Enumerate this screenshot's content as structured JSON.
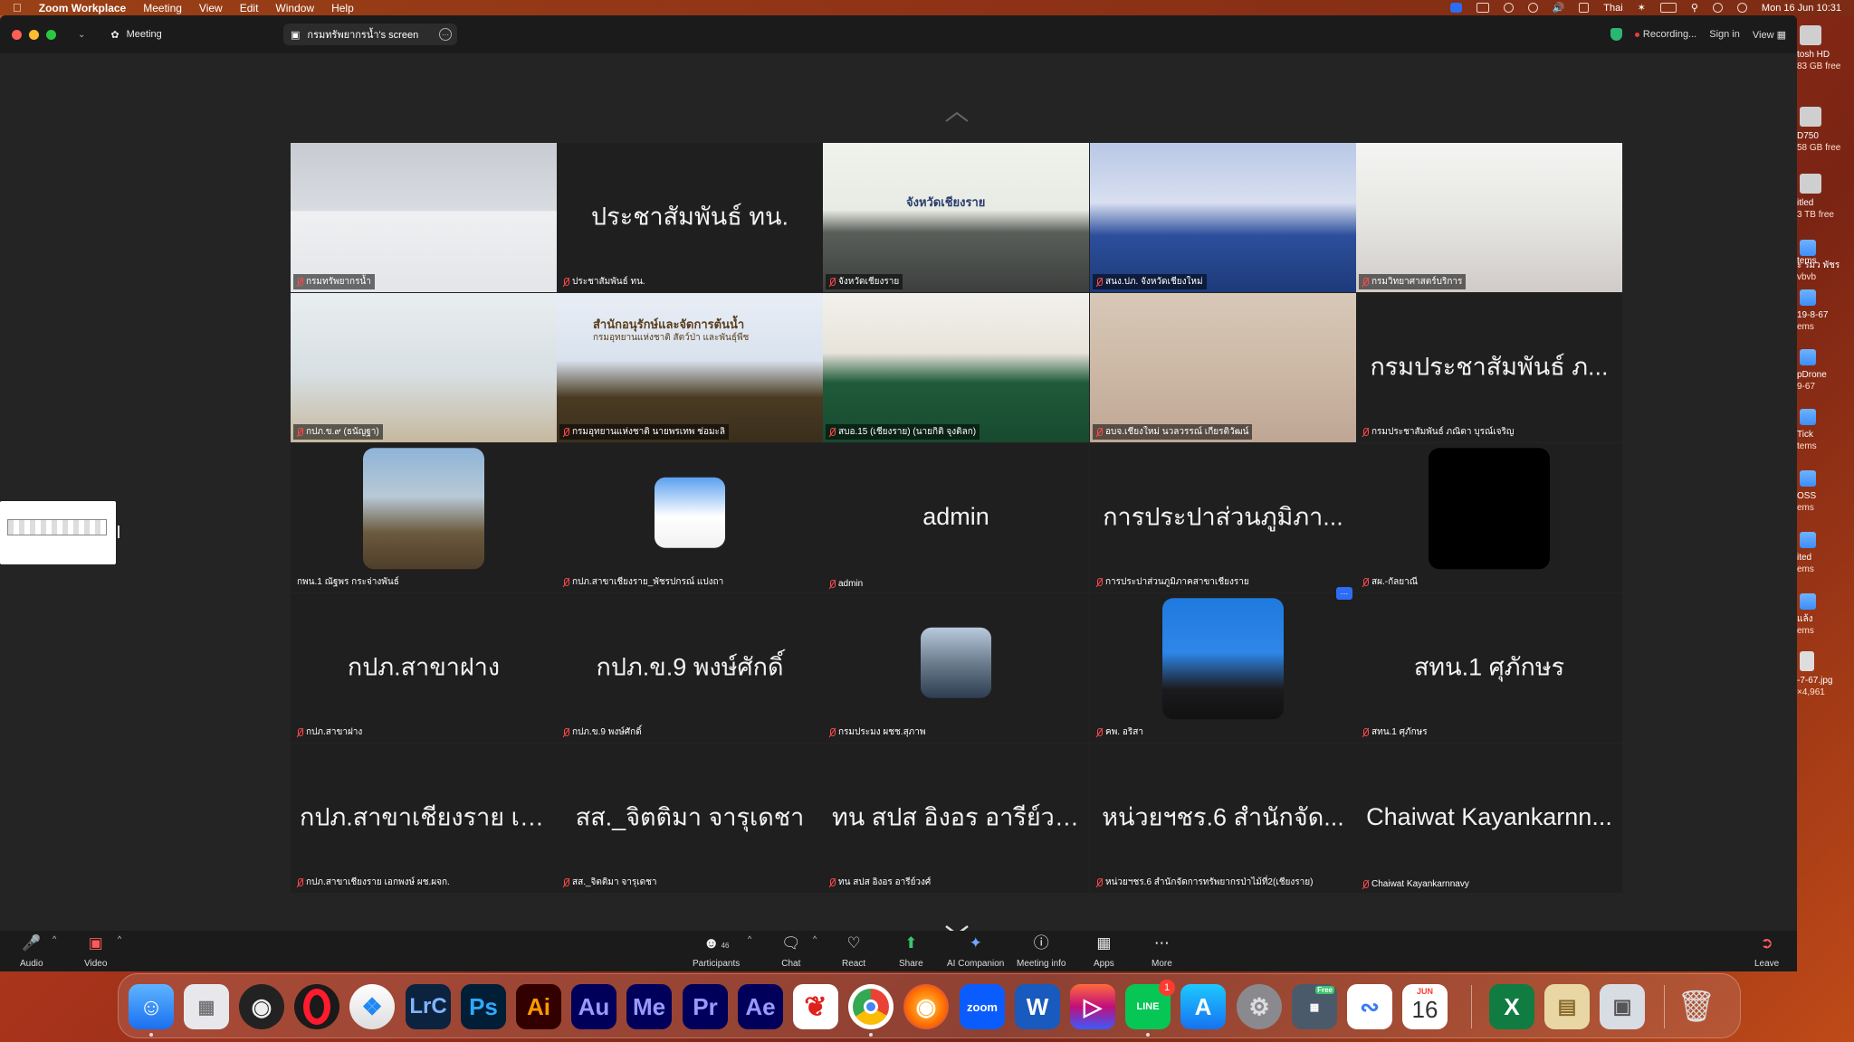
{
  "menubar": {
    "app_name": "Zoom Workplace",
    "menus": [
      "Meeting",
      "View",
      "Edit",
      "Window",
      "Help"
    ],
    "input_source": "Thai",
    "datetime": "Mon 16 Jun  10:31"
  },
  "titlebar": {
    "meeting_label": "Meeting",
    "share_tab_label": "กรมทรัพยากรน้ำ's screen",
    "recording_label": "Recording...",
    "sign_in": "Sign in",
    "view_label": "View"
  },
  "tiles": [
    {
      "label": "กรมทรัพยากรน้ำ",
      "kind": "video",
      "active": true
    },
    {
      "label": "ประชาสัมพันธ์ ทน.",
      "kind": "name",
      "big": "ประชาสัมพันธ์ ทน."
    },
    {
      "label": "จังหวัดเชียงราย",
      "kind": "video"
    },
    {
      "label": "สนง.ปภ. จังหวัดเชียงใหม่",
      "kind": "video"
    },
    {
      "label": "กรมวิทยาศาสตร์บริการ",
      "kind": "video"
    },
    {
      "label": "กปภ.ข.๙ (ธนัญฐา)",
      "kind": "video"
    },
    {
      "label": "กรมอุทยานแห่งชาติ นายพรเทพ ช่อมะลิ",
      "kind": "video"
    },
    {
      "label": "สบอ.15 (เชียงราย) (นายกิติ จุงติลก)",
      "kind": "video"
    },
    {
      "label": "อบจ.เชียงใหม่ นวลวรรณ์ เกียรติวัฒน์",
      "kind": "video"
    },
    {
      "label": "กรมประชาสัมพันธ์ ภณิดา บุรณ์เจริญ",
      "kind": "name",
      "big": "กรมประชาสัมพันธ์ ภ..."
    },
    {
      "label": "กพน.1 ณัฐพร กระจ่างพันธ์",
      "kind": "avatar"
    },
    {
      "label": "กปภ.สาขาเชียงราย_พัชรปกรณ์ แปงถา",
      "kind": "avatar"
    },
    {
      "label": "admin",
      "kind": "name",
      "big": "admin"
    },
    {
      "label": "การประปาส่วนภูมิภาคสาขาเชียงราย",
      "kind": "name",
      "big": "การประปาส่วนภูมิภา..."
    },
    {
      "label": "สผ.-กัลยาณี",
      "kind": "avatar-black"
    },
    {
      "label": "กปภ.สาขาฝาง",
      "kind": "name",
      "big": "กปภ.สาขาฝาง"
    },
    {
      "label": "กปภ.ข.9 พงษ์ศักดิ์",
      "kind": "name",
      "big": "กปภ.ข.9 พงษ์ศักดิ์"
    },
    {
      "label": "กรมประมง ผชช.สุภาพ",
      "kind": "avatar"
    },
    {
      "label": "คพ. อริสา",
      "kind": "avatar"
    },
    {
      "label": "สทน.1 ศุภักษร",
      "kind": "name",
      "big": "สทน.1 ศุภักษร"
    },
    {
      "label": "กปภ.สาขาเชียงราย เอกพงษ์ ผช.ผจก.",
      "kind": "name",
      "big": "กปภ.สาขาเชียงราย เอ..."
    },
    {
      "label": "สส._จิตติมา จารุเดชา",
      "kind": "name",
      "big": "สส._จิตติมา จารุเดชา"
    },
    {
      "label": "ทน สปส อิงอร อารีย์วงศ์",
      "kind": "name",
      "big": "ทน สปส อิงอร อารีย์วงศ์"
    },
    {
      "label": "หน่วยฯชร.6 สำนักจัดการทรัพยากรป่าไม้ที่2(เชียงราย)",
      "kind": "name",
      "big": "หน่วยฯชร.6 สำนักจัด..."
    },
    {
      "label": "Chaiwat Kayankarnnavy",
      "kind": "name",
      "big": "Chaiwat Kayankarnn..."
    }
  ],
  "video_text": {
    "sign_chiangrai": "จังหวัดเชียงราย",
    "banner_1": "สำนักอนุรักษ์และจัดการต้นน้ำ",
    "banner_2": "กรมอุทยานแห่งชาติ สัตว์ป่า และพันธุ์พืช"
  },
  "toolbar": {
    "audio": "Audio",
    "video": "Video",
    "participants": "Participants",
    "participant_count": "46",
    "chat": "Chat",
    "react": "React",
    "share": "Share",
    "ai_companion": "AI Companion",
    "meeting_info": "Meeting info",
    "apps": "Apps",
    "more": "More",
    "leave": "Leave"
  },
  "desktop": [
    {
      "name": "tosh HD",
      "detail": "83 GB free"
    },
    {
      "name": "D750",
      "detail": "58 GB free"
    },
    {
      "name": "itled",
      "detail": "3 TB free"
    },
    {
      "name": "ะ รมว พัชร",
      "detail": "vbvb"
    },
    {
      "name": "tems",
      "detail": ""
    },
    {
      "name": "19-8-67",
      "detail": "ems"
    },
    {
      "name": "pDrone",
      "detail": "9-67"
    },
    {
      "name": "Tick",
      "detail": "tems"
    },
    {
      "name": "OSS",
      "detail": "ems"
    },
    {
      "name": "ited",
      "detail": "ems"
    },
    {
      "name": "แล้ง",
      "detail": "ems"
    },
    {
      "name": "-7-67.jpg",
      "detail": "×4,961"
    }
  ],
  "dock": {
    "lightroom": "LrC",
    "photoshop": "Ps",
    "illustrator": "Ai",
    "audition": "Au",
    "media_encoder": "Me",
    "premiere": "Pr",
    "after_effects": "Ae",
    "zoom": "zoom",
    "line": "LINE",
    "line_badge": "1",
    "calendar_month": "JUN",
    "calendar_day": "16",
    "free_tag": "Free"
  },
  "colors": {
    "active_speaker": "#3cc46e",
    "muted": "#ff4a4a",
    "accent": "#2d6cf5"
  }
}
